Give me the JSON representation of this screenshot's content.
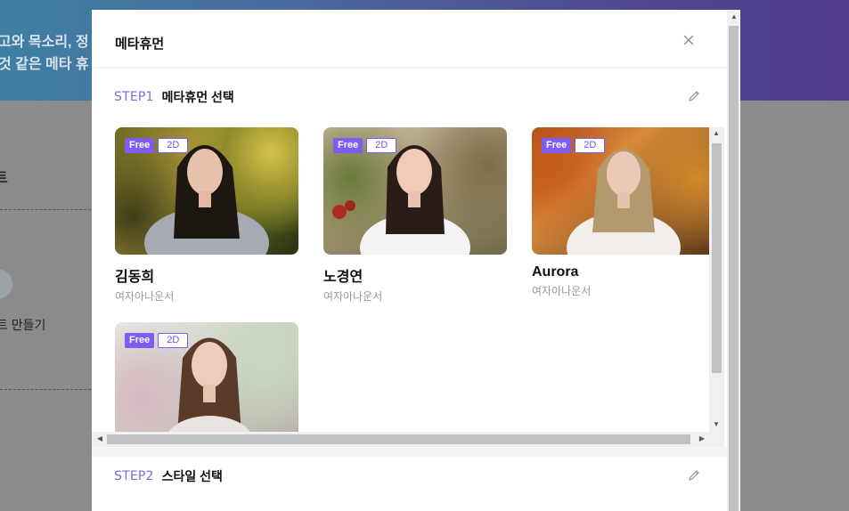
{
  "background": {
    "banner_line1": "고와 목소리, 정",
    "banner_line2": "것 같은 메타 휴",
    "section_title": "트",
    "make_label": "트 만들기"
  },
  "modal": {
    "title": "메타휴먼",
    "close_icon": "close-icon",
    "step1": {
      "number": "STEP1",
      "name": "메타휴먼 선택"
    },
    "step2": {
      "number": "STEP2",
      "name": "스타일 선택"
    },
    "edit_icon": "pencil-icon",
    "badge_free": "Free",
    "badge_2d": "2D",
    "metahumans": [
      {
        "name": "김동희",
        "role": "여자아나운서"
      },
      {
        "name": "노경연",
        "role": "여자아나운서"
      },
      {
        "name": "Aurora",
        "role": "여자아나운서"
      },
      {
        "name": "",
        "role": ""
      }
    ]
  },
  "colors": {
    "accent": "#7c5cf2",
    "step_text": "#7b6be0"
  }
}
